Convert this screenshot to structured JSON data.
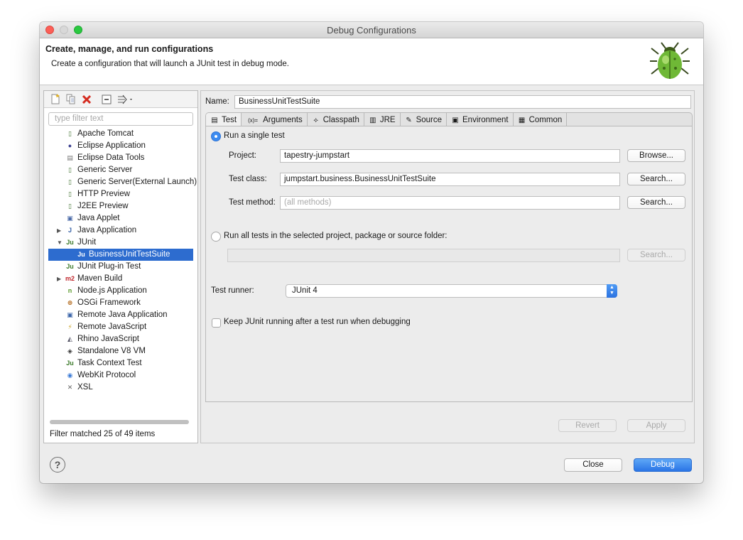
{
  "window": {
    "title": "Debug Configurations"
  },
  "banner": {
    "title": "Create, manage, and run configurations",
    "subtitle": "Create a configuration that will launch a JUnit test in debug mode.",
    "icon": "debug-bug-icon"
  },
  "left": {
    "filter_placeholder": "type filter text",
    "toolbar_icons": [
      "new-config-icon",
      "duplicate-icon",
      "delete-icon",
      "collapse-all-icon",
      "filter-menu-icon"
    ],
    "tree": [
      {
        "label": "Apache Tomcat",
        "icon": "server-icon"
      },
      {
        "label": "Eclipse Application",
        "icon": "eclipse-icon"
      },
      {
        "label": "Eclipse Data Tools",
        "icon": "database-icon"
      },
      {
        "label": "Generic Server",
        "icon": "server-icon"
      },
      {
        "label": "Generic Server(External Launch)",
        "icon": "server-icon"
      },
      {
        "label": "HTTP Preview",
        "icon": "server-icon"
      },
      {
        "label": "J2EE Preview",
        "icon": "server-icon"
      },
      {
        "label": "Java Applet",
        "icon": "applet-icon"
      },
      {
        "label": "Java Application",
        "icon": "java-app-icon",
        "expandable": true
      },
      {
        "label": "JUnit",
        "icon": "junit-icon",
        "expanded": true
      },
      {
        "label": "BusinessUnitTestSuite",
        "icon": "junit-icon",
        "child": true,
        "selected": true
      },
      {
        "label": "JUnit Plug-in Test",
        "icon": "junit-icon"
      },
      {
        "label": "Maven Build",
        "icon": "maven-icon",
        "expandable": true
      },
      {
        "label": "Node.js Application",
        "icon": "nodejs-icon"
      },
      {
        "label": "OSGi Framework",
        "icon": "osgi-icon"
      },
      {
        "label": "Remote Java Application",
        "icon": "remote-java-icon"
      },
      {
        "label": "Remote JavaScript",
        "icon": "remote-js-icon"
      },
      {
        "label": "Rhino JavaScript",
        "icon": "rhino-icon"
      },
      {
        "label": "Standalone V8 VM",
        "icon": "v8-icon"
      },
      {
        "label": "Task Context Test",
        "icon": "junit-icon"
      },
      {
        "label": "WebKit Protocol",
        "icon": "webkit-icon"
      },
      {
        "label": "XSL",
        "icon": "xsl-icon"
      }
    ],
    "filter_status": "Filter matched 25 of 49 items"
  },
  "right": {
    "name_label": "Name:",
    "name_value": "BusinessUnitTestSuite",
    "tabs": [
      {
        "label": "Test",
        "icon": "test-tab-icon",
        "active": true
      },
      {
        "label": "Arguments",
        "icon": "arguments-tab-icon"
      },
      {
        "label": "Classpath",
        "icon": "classpath-tab-icon"
      },
      {
        "label": "JRE",
        "icon": "jre-tab-icon"
      },
      {
        "label": "Source",
        "icon": "source-tab-icon"
      },
      {
        "label": "Environment",
        "icon": "environment-tab-icon"
      },
      {
        "label": "Common",
        "icon": "common-tab-icon"
      }
    ],
    "test": {
      "single_test_label": "Run a single test",
      "project_label": "Project:",
      "project_value": "tapestry-jumpstart",
      "browse_label": "Browse...",
      "class_label": "Test class:",
      "class_value": "jumpstart.business.BusinessUnitTestSuite",
      "search_label": "Search...",
      "method_label": "Test method:",
      "method_placeholder": "(all methods)",
      "all_tests_label": "Run all tests in the selected project, package or source folder:",
      "runner_label": "Test runner:",
      "runner_value": "JUnit 4",
      "keep_running_label": "Keep JUnit running after a test run when debugging"
    },
    "revert_label": "Revert",
    "apply_label": "Apply"
  },
  "footer": {
    "help_label": "?",
    "close_label": "Close",
    "debug_label": "Debug"
  },
  "colors": {
    "selection": "#2d6ccf",
    "primary_button": "#2a74e6",
    "close_dot": "#fc5f57",
    "max_dot": "#2ac940"
  }
}
